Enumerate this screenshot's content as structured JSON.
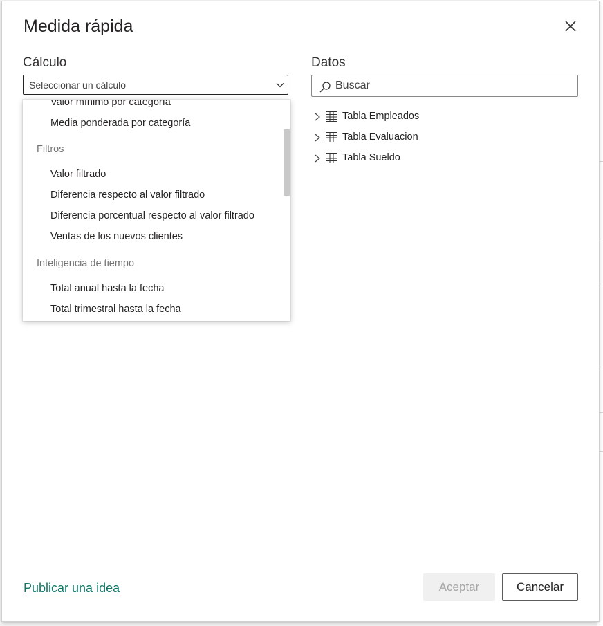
{
  "dialog": {
    "title": "Medida rápida",
    "close_icon": "close-icon"
  },
  "calculo": {
    "label": "Cálculo",
    "select_placeholder": "Seleccionar un cálculo",
    "chevron_icon": "chevron-down-icon",
    "dropdown": {
      "items": [
        {
          "type": "item",
          "label": "Valor mínimo por categoría"
        },
        {
          "type": "item",
          "label": "Media ponderada por categoría"
        },
        {
          "type": "header",
          "label": "Filtros"
        },
        {
          "type": "item",
          "label": "Valor filtrado"
        },
        {
          "type": "item",
          "label": "Diferencia respecto al valor filtrado"
        },
        {
          "type": "item",
          "label": "Diferencia porcentual respecto al valor filtrado"
        },
        {
          "type": "item",
          "label": "Ventas de los nuevos clientes"
        },
        {
          "type": "header",
          "label": "Inteligencia de tiempo"
        },
        {
          "type": "item",
          "label": "Total anual hasta la fecha"
        },
        {
          "type": "item",
          "label": "Total trimestral hasta la fecha"
        }
      ]
    }
  },
  "datos": {
    "label": "Datos",
    "search_placeholder": "Buscar",
    "search_icon": "search-icon",
    "tables": [
      {
        "label": "Tabla Empleados",
        "icon": "table-icon"
      },
      {
        "label": "Tabla Evaluacion",
        "icon": "table-icon"
      },
      {
        "label": "Tabla Sueldo",
        "icon": "table-icon"
      }
    ]
  },
  "footer": {
    "publish_link": "Publicar una idea",
    "accept_label": "Aceptar",
    "cancel_label": "Cancelar"
  },
  "colors": {
    "link": "#117865",
    "disabled_text": "#a6a6a6",
    "text": "#252423"
  }
}
